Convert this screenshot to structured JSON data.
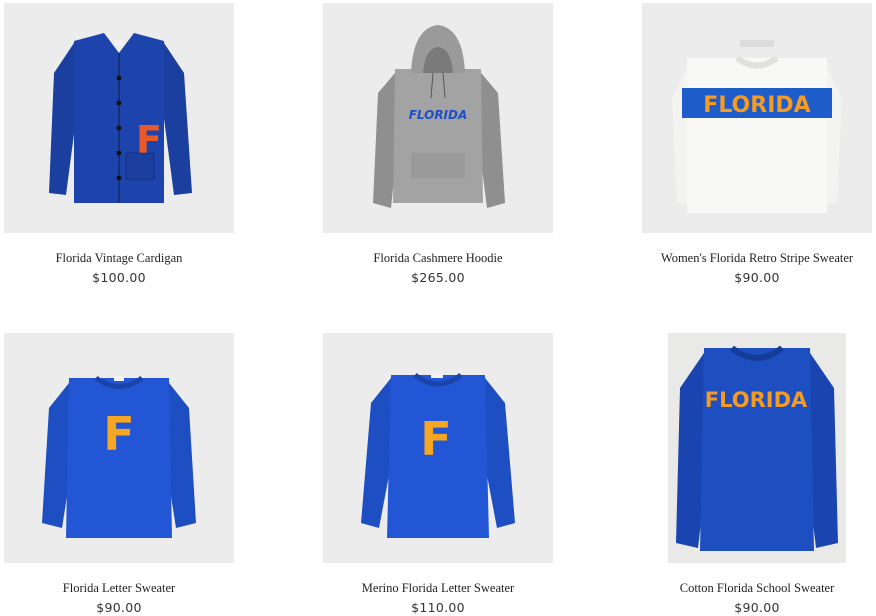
{
  "products": [
    {
      "name": "Florida Vintage Cardigan",
      "price": "$100.00",
      "image_icon": "cardigan-image",
      "text_on_garment": "F"
    },
    {
      "name": "Florida Cashmere Hoodie",
      "price": "$265.00",
      "image_icon": "hoodie-image",
      "text_on_garment": "FLORIDA"
    },
    {
      "name": "Women's Florida Retro Stripe Sweater",
      "price": "$90.00",
      "image_icon": "stripe-sweater-image",
      "text_on_garment": "FLORIDA"
    },
    {
      "name": "Florida Letter Sweater",
      "price": "$90.00",
      "image_icon": "letter-sweater-image",
      "text_on_garment": "F"
    },
    {
      "name": "Merino Florida Letter Sweater",
      "price": "$110.00",
      "image_icon": "merino-sweater-image",
      "text_on_garment": "F"
    },
    {
      "name": "Cotton Florida School Sweater",
      "price": "$90.00",
      "image_icon": "school-sweater-image",
      "text_on_garment": "FLORIDA"
    }
  ],
  "colors": {
    "royal_blue": "#1e4fc9",
    "navy_blue": "#1a3f9e",
    "orange": "#f59a23",
    "heather_grey": "#9a9a9a",
    "off_white": "#f6f6f4",
    "thumb_background": "#ececec"
  }
}
